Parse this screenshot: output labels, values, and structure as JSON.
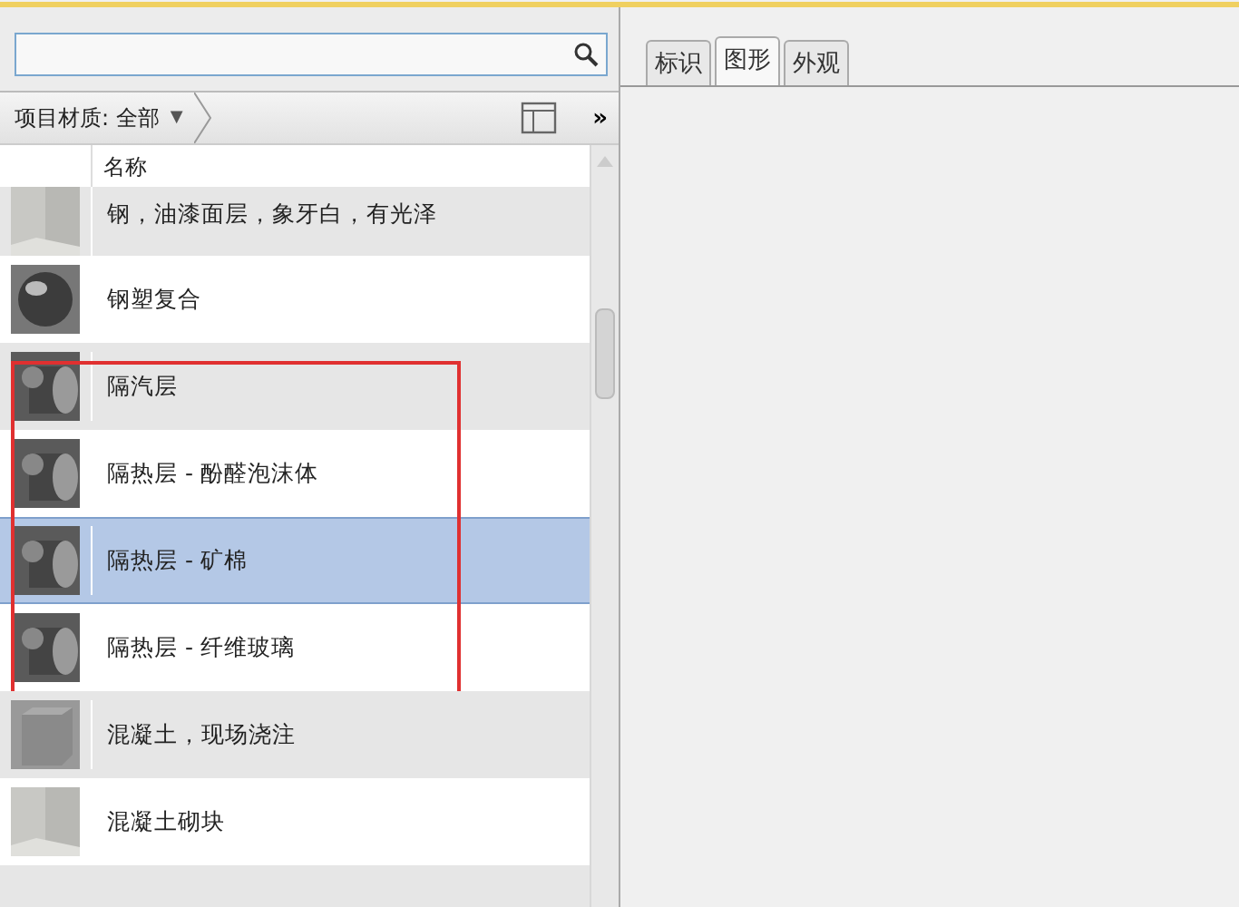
{
  "filter": {
    "label": "项目材质: 全部",
    "caret": "▼",
    "more": "»"
  },
  "list": {
    "column": "名称",
    "rows": [
      {
        "name": "钢，油漆面层，象牙白，有光泽",
        "kind": "panel",
        "selected": false,
        "framed": false
      },
      {
        "name": "钢塑复合",
        "kind": "sphere",
        "selected": false,
        "framed": false
      },
      {
        "name": "隔汽层",
        "kind": "cylinder",
        "selected": false,
        "framed": true
      },
      {
        "name": "隔热层 - 酚醛泡沫体",
        "kind": "cylinder",
        "selected": false,
        "framed": true
      },
      {
        "name": "隔热层 - 矿棉",
        "kind": "cylinder",
        "selected": true,
        "framed": true
      },
      {
        "name": "隔热层 - 纤维玻璃",
        "kind": "cylinder",
        "selected": false,
        "framed": true
      },
      {
        "name": "混凝土，现场浇注",
        "kind": "cube",
        "selected": false,
        "framed": false
      },
      {
        "name": "混凝土砌块",
        "kind": "panel",
        "selected": false,
        "framed": false
      }
    ]
  },
  "tabs": [
    {
      "label": "标识",
      "selected": false
    },
    {
      "label": "图形",
      "selected": true
    },
    {
      "label": "外观",
      "selected": false
    }
  ]
}
